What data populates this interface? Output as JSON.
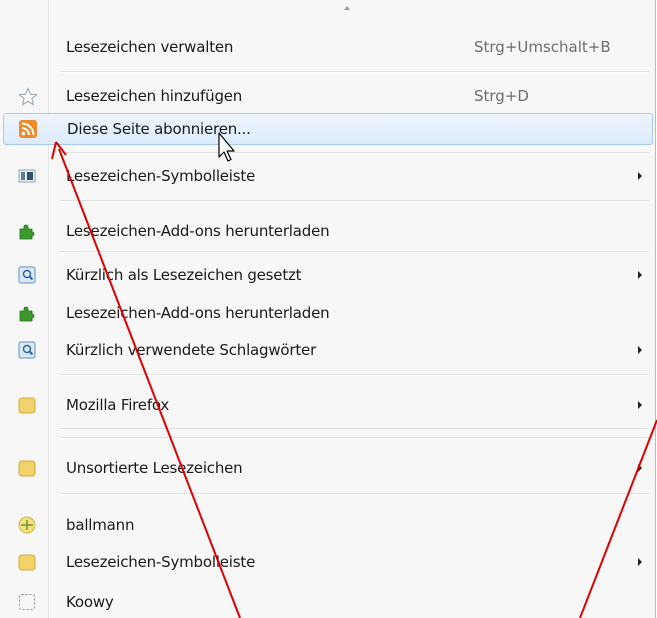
{
  "menu": {
    "items": [
      {
        "label": "Lesezeichen verwalten",
        "shortcut": "Strg+Umschalt+B"
      },
      {
        "label": "Lesezeichen hinzufügen",
        "shortcut": "Strg+D"
      },
      {
        "label": "Diese Seite abonnieren..."
      },
      {
        "label": "Lesezeichen-Symbolleiste"
      },
      {
        "label": "Lesezeichen-Add-ons herunterladen"
      },
      {
        "label": "Kürzlich als Lesezeichen gesetzt"
      },
      {
        "label": "Lesezeichen-Add-ons herunterladen"
      },
      {
        "label": "Kürzlich verwendete Schlagwörter"
      },
      {
        "label": "Mozilla Firefox"
      },
      {
        "label": "Unsortierte Lesezeichen"
      },
      {
        "label": "ballmann"
      },
      {
        "label": "Lesezeichen-Symbolleiste"
      },
      {
        "label": "Koowy"
      }
    ]
  },
  "icons": {
    "star": "star-outline",
    "rss": "rss-feed",
    "toolbar": "bookmarks-toolbar",
    "puzzle": "puzzle-piece",
    "recent": "recent-bookmarks",
    "folder": "folder",
    "ballmann": "favicon-ballmann",
    "koowy": "favicon-placeholder"
  },
  "colors": {
    "highlight": "#dcebfc",
    "highlight_border": "#a8caf0",
    "annotation_arrow": "#e00000",
    "rss": "#f08a24",
    "puzzle": "#3c9a2c",
    "folder": "#f2d36b"
  }
}
